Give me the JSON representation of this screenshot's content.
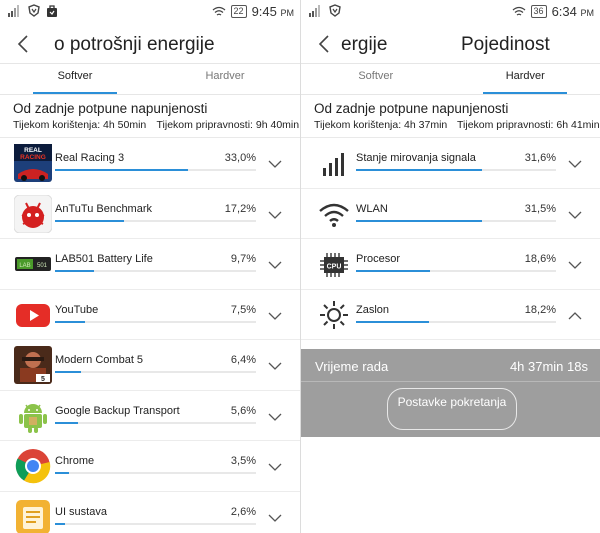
{
  "left": {
    "status": {
      "battery": "22",
      "time": "9:45",
      "ampm": "PM"
    },
    "title": "o potrošnji energije",
    "tabs": [
      {
        "label": "Softver",
        "active": true
      },
      {
        "label": "Hardver",
        "active": false
      }
    ],
    "section_title": "Od zadnje potpune napunjenosti",
    "usage_label": "Tijekom korištenja: 4h 50min",
    "standby_label": "Tijekom pripravnosti: 9h 40min",
    "items": [
      {
        "name": "Real Racing 3",
        "percent": "33,0%",
        "value": 33.0,
        "icon": "real-racing-icon"
      },
      {
        "name": "AnTuTu Benchmark",
        "percent": "17,2%",
        "value": 17.2,
        "icon": "antutu-icon"
      },
      {
        "name": "LAB501 Battery Life",
        "percent": "9,7%",
        "value": 9.7,
        "icon": "lab501-icon"
      },
      {
        "name": "YouTube",
        "percent": "7,5%",
        "value": 7.5,
        "icon": "youtube-icon"
      },
      {
        "name": "Modern Combat 5",
        "percent": "6,4%",
        "value": 6.4,
        "icon": "modern-combat-icon"
      },
      {
        "name": "Google Backup Transport",
        "percent": "5,6%",
        "value": 5.6,
        "icon": "android-icon"
      },
      {
        "name": "Chrome",
        "percent": "3,5%",
        "value": 3.5,
        "icon": "chrome-icon"
      },
      {
        "name": "UI sustava",
        "percent": "2,6%",
        "value": 2.6,
        "icon": "system-ui-icon"
      }
    ]
  },
  "right": {
    "status": {
      "battery": "36",
      "time": "6:34",
      "ampm": "PM"
    },
    "title_left": "ergije",
    "title_right": "Pojedinost",
    "tabs": [
      {
        "label": "Softver",
        "active": false
      },
      {
        "label": "Hardver",
        "active": true
      }
    ],
    "section_title": "Od zadnje potpune napunjenosti",
    "usage_label": "Tijekom korištenja: 4h 37min",
    "standby_label": "Tijekom pripravnosti: 6h 41min",
    "items": [
      {
        "name": "Stanje mirovanja signala",
        "percent": "31,6%",
        "value": 31.6,
        "icon": "signal-bars-icon",
        "expanded": false
      },
      {
        "name": "WLAN",
        "percent": "31,5%",
        "value": 31.5,
        "icon": "wifi-icon",
        "expanded": false
      },
      {
        "name": "Procesor",
        "percent": "18,6%",
        "value": 18.6,
        "icon": "cpu-icon",
        "expanded": false
      },
      {
        "name": "Zaslon",
        "percent": "18,2%",
        "value": 18.2,
        "icon": "sun-icon",
        "expanded": true
      }
    ],
    "detail": {
      "label": "Vrijeme rada",
      "value": "4h 37min 18s",
      "button": "Postavke pokretanja"
    }
  },
  "colors": {
    "accent": "#2b8fd8",
    "detail_bg": "#9e9e9e"
  }
}
